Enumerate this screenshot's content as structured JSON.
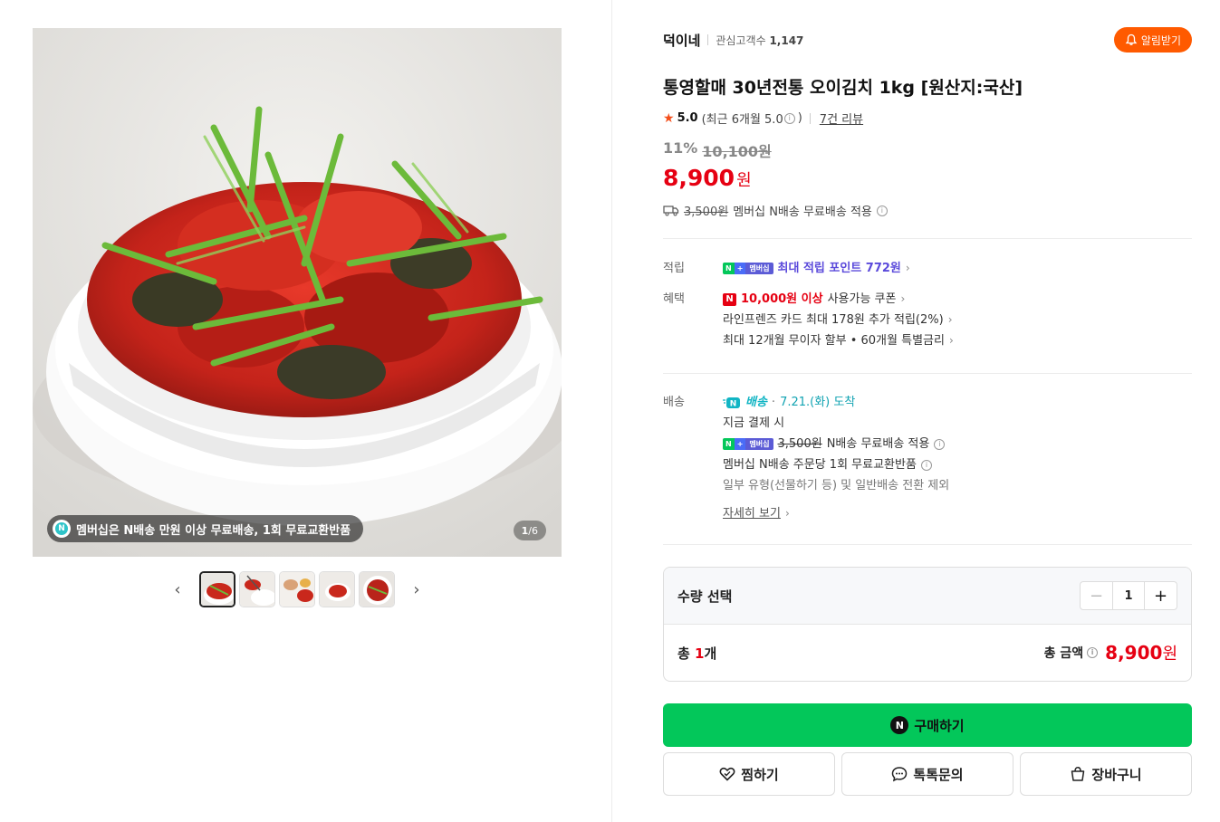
{
  "gallery": {
    "promo_text": "멤버십은 N배송 만원 이상 무료배송, 1회 무료교환반품",
    "promo_badge": "N",
    "counter_current": "1",
    "counter_total": "/6",
    "prev_icon": "chevron-left",
    "next_icon": "chevron-right"
  },
  "store": {
    "name": "덕이네",
    "fans_label": "관심고객수",
    "fans_count": "1,147",
    "alarm_label": "알림받기"
  },
  "product": {
    "title": "통영할매 30년전통 오이김치 1kg [원산지:국산]",
    "rating_score": "5.0",
    "rating_recent": "(최근 6개월 5.0",
    "rating_close": ")",
    "review_link": "7건 리뷰",
    "discount_pct": "11%",
    "original_price": "10,100원",
    "price": "8,900",
    "price_unit": "원",
    "ship_original": "3,500원",
    "ship_text": "멤버십 N배송 무료배송 적용"
  },
  "points": {
    "label": "적립",
    "badge_a": "N",
    "badge_b": "+",
    "badge_c": "멤버십",
    "text": "최대 적립 포인트 772원"
  },
  "benefit": {
    "label": "혜택",
    "coupon_amount": "10,000원 이상",
    "coupon_text": "사용가능 쿠폰",
    "card_text": "라인프렌즈 카드 최대 178원 추가 적립(2%)",
    "installment_text": "최대 12개월 무이자 할부 • 60개월 특별금리"
  },
  "delivery": {
    "label": "배송",
    "n_delivery": "배송",
    "arrival": "7.21.(화) 도착",
    "pay_now": "지금 결제 시",
    "ship_original": "3,500원",
    "ship_free": "N배송 무료배송 적용",
    "exchange": "멤버십 N배송 주문당 1회 무료교환반품",
    "exclusion": "일부 유형(선물하기 등) 및 일반배송 전환 제외",
    "detail_link": "자세히 보기"
  },
  "quantity": {
    "label": "수량 선택",
    "value": "1",
    "count_prefix": "총 ",
    "count": "1",
    "count_suffix": "개",
    "total_label": "총 금액",
    "total_price": "8,900",
    "total_unit": "원"
  },
  "actions": {
    "buy": "구매하기",
    "wish": "찜하기",
    "talk": "톡톡문의",
    "cart": "장바구니"
  },
  "colors": {
    "accent_green": "#03c75a",
    "price_red": "#e60012",
    "alarm_orange": "#ff5a00"
  }
}
